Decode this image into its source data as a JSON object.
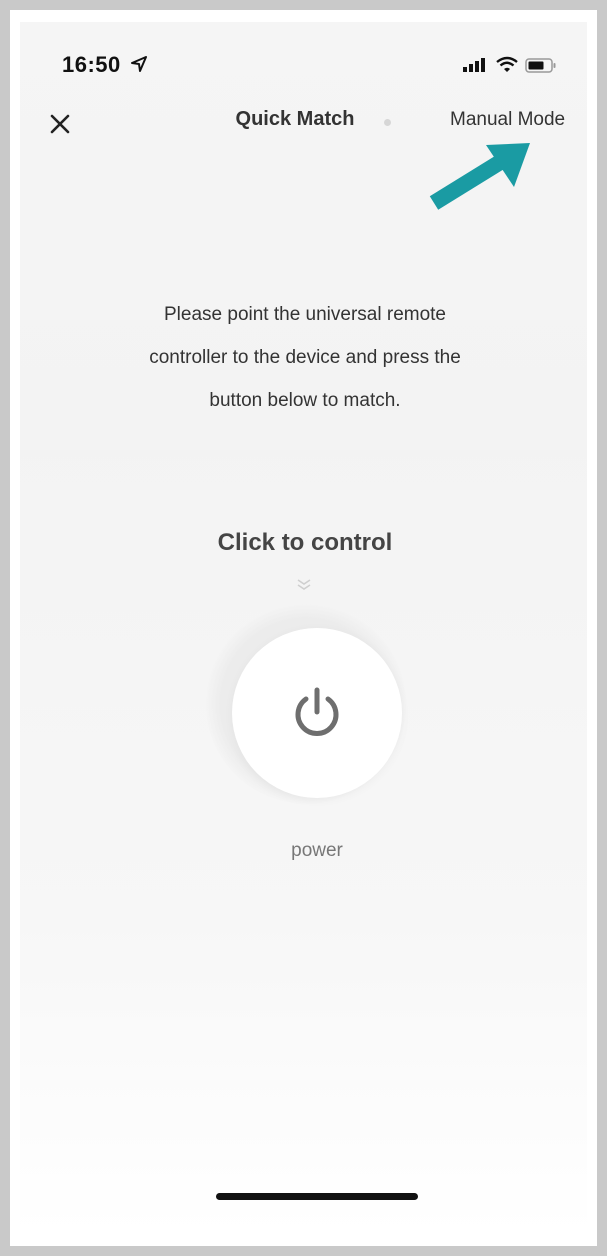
{
  "status_bar": {
    "time": "16:50",
    "location_icon": "location-arrow-icon",
    "signal_icon": "cellular-signal-icon",
    "wifi_icon": "wifi-icon",
    "battery_icon": "battery-icon"
  },
  "nav": {
    "close_icon": "close-icon",
    "title": "Quick Match",
    "manual_mode_label": "Manual Mode"
  },
  "annotation": {
    "arrow_icon": "pointer-arrow-icon",
    "arrow_color": "#1a9ba3"
  },
  "main": {
    "instruction_lines": [
      "Please point the universal remote",
      "controller to the device and press the",
      "button below to match."
    ],
    "click_to_control": "Click to control",
    "chevron_icon": "chevron-down-icon",
    "power_icon": "power-icon",
    "power_label": "power"
  }
}
